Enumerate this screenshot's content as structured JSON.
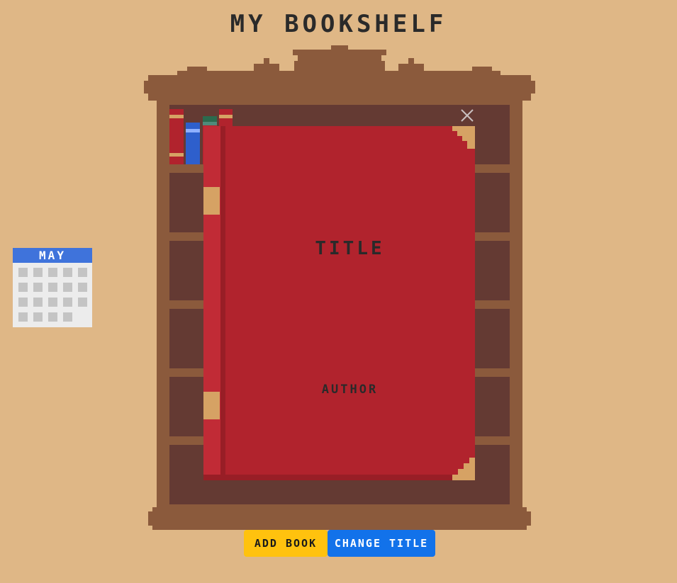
{
  "header": {
    "title": "MY BOOKSHELF"
  },
  "calendar": {
    "month": "MAY",
    "day_count": 19
  },
  "book_view": {
    "title": "TITLE",
    "author": "AUTHOR",
    "close_icon": "close-icon"
  },
  "toolbar": {
    "add_book_label": "ADD BOOK",
    "change_title_label": "CHANGE TITLE"
  },
  "colors": {
    "background": "#dfb786",
    "wood": "#8b5a3c",
    "shelf_interior": "#643a33",
    "book_red": "#b1232d",
    "accent_gold": "#d6a264",
    "add_button": "#ffc20e",
    "change_button": "#1272ea",
    "calendar_header": "#3f73db"
  },
  "shelf_books": [
    {
      "color": "#b1232d",
      "band": "#d6a264"
    },
    {
      "color": "#2e5fcc",
      "band": "#8fb0ff"
    },
    {
      "color": "#b1232d",
      "band": "#4f8a7a",
      "top": "#2b6a4e"
    },
    {
      "color": "#b1232d",
      "band": "#d6a264"
    }
  ]
}
